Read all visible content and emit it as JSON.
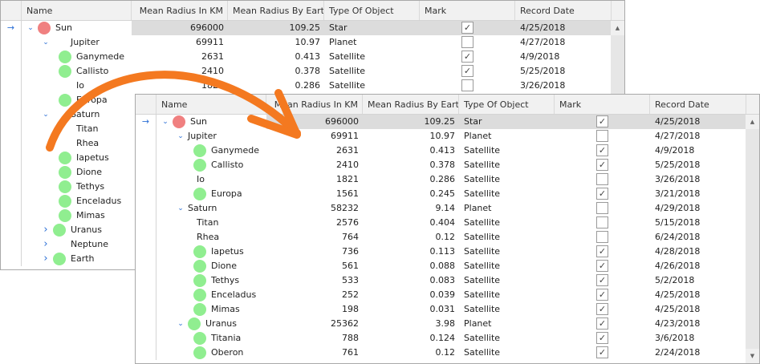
{
  "columns": [
    "Name",
    "Mean Radius In KM",
    "Mean Radius By Earth",
    "Type Of Object",
    "Mark",
    "Record Date"
  ],
  "colors": {
    "star": "#f08080",
    "satellite": "#90ee90",
    "accent": "#2b6fd6",
    "arrow": "#f47920",
    "selected": "#dcdcdc"
  },
  "back_rows": [
    {
      "name": "Sun",
      "level": 0,
      "exp": "down",
      "icon": "star",
      "km": "696000",
      "earth": "109.25",
      "type": "Star",
      "mark": true,
      "date": "4/25/2018",
      "sel": true
    },
    {
      "name": "Jupiter",
      "level": 1,
      "exp": "down",
      "icon": null,
      "km": "69911",
      "earth": "10.97",
      "type": "Planet",
      "mark": false,
      "date": "4/27/2018"
    },
    {
      "name": "Ganymede",
      "level": 2,
      "icon": "satellite",
      "km": "2631",
      "earth": "0.413",
      "type": "Satellite",
      "mark": true,
      "date": "4/9/2018"
    },
    {
      "name": "Callisto",
      "level": 2,
      "icon": "satellite",
      "km": "2410",
      "earth": "0.378",
      "type": "Satellite",
      "mark": true,
      "date": "5/25/2018"
    },
    {
      "name": "Io",
      "level": 2,
      "icon": null,
      "km": "1821",
      "earth": "0.286",
      "type": "Satellite",
      "mark": false,
      "date": "3/26/2018"
    },
    {
      "name": "Europa",
      "level": 2,
      "icon": "satellite"
    },
    {
      "name": "Saturn",
      "level": 1,
      "exp": "down",
      "icon": null
    },
    {
      "name": "Titan",
      "level": 2,
      "icon": null
    },
    {
      "name": "Rhea",
      "level": 2,
      "icon": null
    },
    {
      "name": "Iapetus",
      "level": 2,
      "icon": "satellite"
    },
    {
      "name": "Dione",
      "level": 2,
      "icon": "satellite"
    },
    {
      "name": "Tethys",
      "level": 2,
      "icon": "satellite"
    },
    {
      "name": "Enceladus",
      "level": 2,
      "icon": "satellite"
    },
    {
      "name": "Mimas",
      "level": 2,
      "icon": "satellite"
    },
    {
      "name": "Uranus",
      "level": 1,
      "exp": "right",
      "icon": "satellite"
    },
    {
      "name": "Neptune",
      "level": 1,
      "exp": "right",
      "icon": null
    },
    {
      "name": "Earth",
      "level": 1,
      "exp": "right",
      "icon": "satellite"
    }
  ],
  "front_rows": [
    {
      "name": "Sun",
      "level": 0,
      "exp": "down",
      "icon": "star",
      "km": "696000",
      "earth": "109.25",
      "type": "Star",
      "mark": true,
      "date": "4/25/2018",
      "sel": true
    },
    {
      "name": "Jupiter",
      "level": 1,
      "exp": "down",
      "icon": null,
      "km": "69911",
      "earth": "10.97",
      "type": "Planet",
      "mark": false,
      "date": "4/27/2018"
    },
    {
      "name": "Ganymede",
      "level": 2,
      "icon": "satellite",
      "km": "2631",
      "earth": "0.413",
      "type": "Satellite",
      "mark": true,
      "date": "4/9/2018"
    },
    {
      "name": "Callisto",
      "level": 2,
      "icon": "satellite",
      "km": "2410",
      "earth": "0.378",
      "type": "Satellite",
      "mark": true,
      "date": "5/25/2018"
    },
    {
      "name": "Io",
      "level": 2,
      "icon": null,
      "km": "1821",
      "earth": "0.286",
      "type": "Satellite",
      "mark": false,
      "date": "3/26/2018"
    },
    {
      "name": "Europa",
      "level": 2,
      "icon": "satellite",
      "km": "1561",
      "earth": "0.245",
      "type": "Satellite",
      "mark": true,
      "date": "3/21/2018"
    },
    {
      "name": "Saturn",
      "level": 1,
      "exp": "down",
      "icon": null,
      "km": "58232",
      "earth": "9.14",
      "type": "Planet",
      "mark": false,
      "date": "4/29/2018"
    },
    {
      "name": "Titan",
      "level": 2,
      "icon": null,
      "km": "2576",
      "earth": "0.404",
      "type": "Satellite",
      "mark": false,
      "date": "5/15/2018"
    },
    {
      "name": "Rhea",
      "level": 2,
      "icon": null,
      "km": "764",
      "earth": "0.12",
      "type": "Satellite",
      "mark": false,
      "date": "6/24/2018"
    },
    {
      "name": "Iapetus",
      "level": 2,
      "icon": "satellite",
      "km": "736",
      "earth": "0.113",
      "type": "Satellite",
      "mark": true,
      "date": "4/28/2018"
    },
    {
      "name": "Dione",
      "level": 2,
      "icon": "satellite",
      "km": "561",
      "earth": "0.088",
      "type": "Satellite",
      "mark": true,
      "date": "4/26/2018"
    },
    {
      "name": "Tethys",
      "level": 2,
      "icon": "satellite",
      "km": "533",
      "earth": "0.083",
      "type": "Satellite",
      "mark": true,
      "date": "5/2/2018"
    },
    {
      "name": "Enceladus",
      "level": 2,
      "icon": "satellite",
      "km": "252",
      "earth": "0.039",
      "type": "Satellite",
      "mark": true,
      "date": "4/25/2018"
    },
    {
      "name": "Mimas",
      "level": 2,
      "icon": "satellite",
      "km": "198",
      "earth": "0.031",
      "type": "Satellite",
      "mark": true,
      "date": "4/25/2018"
    },
    {
      "name": "Uranus",
      "level": 1,
      "exp": "down",
      "icon": "satellite",
      "km": "25362",
      "earth": "3.98",
      "type": "Planet",
      "mark": true,
      "date": "4/23/2018"
    },
    {
      "name": "Titania",
      "level": 2,
      "icon": "satellite",
      "km": "788",
      "earth": "0.124",
      "type": "Satellite",
      "mark": true,
      "date": "3/6/2018"
    },
    {
      "name": "Oberon",
      "level": 2,
      "icon": "satellite",
      "km": "761",
      "earth": "0.12",
      "type": "Satellite",
      "mark": true,
      "date": "2/24/2018"
    }
  ]
}
